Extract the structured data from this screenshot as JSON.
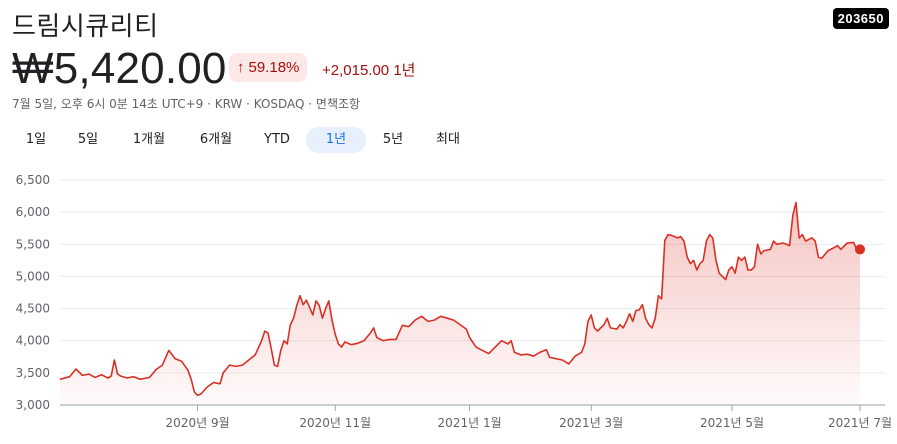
{
  "header": {
    "company_name": "드림시큐리티",
    "ticker": "203650"
  },
  "quote": {
    "price": "₩5,420.00",
    "percent_change": "59.18%",
    "abs_change": "+2,015.00 1년",
    "meta": "7월 5일, 오후 6시 0분 14초 UTC+9 · KRW · KOSDAQ · 면책조항"
  },
  "tabs": [
    {
      "label": "1일",
      "active": false
    },
    {
      "label": "5일",
      "active": false
    },
    {
      "label": "1개월",
      "active": false
    },
    {
      "label": "6개월",
      "active": false
    },
    {
      "label": "YTD",
      "active": false
    },
    {
      "label": "1년",
      "active": true
    },
    {
      "label": "5년",
      "active": false
    },
    {
      "label": "최대",
      "active": false
    }
  ],
  "colors": {
    "line": "#d93025",
    "positive": "#a50e0e",
    "badge_bg": "#fce8e6",
    "active_tab": "#1a73e8"
  },
  "chart_data": {
    "type": "area",
    "y_ticks": [
      "6,500",
      "6,000",
      "5,500",
      "5,000",
      "4,500",
      "4,000",
      "3,500",
      "3,000"
    ],
    "ylim": [
      3000,
      6500
    ],
    "x_ticks": [
      "2020년 9월",
      "2020년 11월",
      "2021년 1월",
      "2021년 3월",
      "2021년 5월",
      "2021년 7월"
    ],
    "x_tick_indices": [
      43,
      86,
      128,
      166,
      210,
      250
    ],
    "n_points": 251,
    "series": [
      {
        "values": [
          [
            0,
            3400
          ],
          [
            3,
            3440
          ],
          [
            5,
            3560
          ],
          [
            7,
            3460
          ],
          [
            9,
            3480
          ],
          [
            11,
            3430
          ],
          [
            13,
            3470
          ],
          [
            15,
            3420
          ],
          [
            16,
            3450
          ],
          [
            17,
            3700
          ],
          [
            18,
            3480
          ],
          [
            19,
            3450
          ],
          [
            21,
            3420
          ],
          [
            23,
            3440
          ],
          [
            25,
            3400
          ],
          [
            28,
            3430
          ],
          [
            30,
            3550
          ],
          [
            32,
            3620
          ],
          [
            34,
            3850
          ],
          [
            36,
            3720
          ],
          [
            38,
            3680
          ],
          [
            40,
            3540
          ],
          [
            41,
            3400
          ],
          [
            42,
            3200
          ],
          [
            43,
            3150
          ],
          [
            44,
            3170
          ],
          [
            46,
            3280
          ],
          [
            48,
            3350
          ],
          [
            50,
            3330
          ],
          [
            51,
            3500
          ],
          [
            53,
            3620
          ],
          [
            55,
            3600
          ],
          [
            57,
            3620
          ],
          [
            59,
            3700
          ],
          [
            61,
            3780
          ],
          [
            63,
            4000
          ],
          [
            64,
            4150
          ],
          [
            65,
            4120
          ],
          [
            66,
            3880
          ],
          [
            67,
            3620
          ],
          [
            68,
            3600
          ],
          [
            69,
            3850
          ],
          [
            70,
            4000
          ],
          [
            71,
            3950
          ],
          [
            72,
            4250
          ],
          [
            73,
            4350
          ],
          [
            74,
            4550
          ],
          [
            75,
            4700
          ],
          [
            76,
            4560
          ],
          [
            77,
            4630
          ],
          [
            78,
            4520
          ],
          [
            79,
            4400
          ],
          [
            80,
            4620
          ],
          [
            81,
            4550
          ],
          [
            82,
            4350
          ],
          [
            83,
            4500
          ],
          [
            84,
            4620
          ],
          [
            85,
            4320
          ],
          [
            86,
            4100
          ],
          [
            87,
            3950
          ],
          [
            88,
            3900
          ],
          [
            89,
            3980
          ],
          [
            91,
            3940
          ],
          [
            93,
            3960
          ],
          [
            95,
            4000
          ],
          [
            97,
            4120
          ],
          [
            98,
            4200
          ],
          [
            99,
            4050
          ],
          [
            101,
            4000
          ],
          [
            103,
            4020
          ],
          [
            105,
            4020
          ],
          [
            107,
            4240
          ],
          [
            109,
            4220
          ],
          [
            111,
            4320
          ],
          [
            113,
            4380
          ],
          [
            115,
            4300
          ],
          [
            117,
            4320
          ],
          [
            119,
            4380
          ],
          [
            121,
            4350
          ],
          [
            123,
            4320
          ],
          [
            125,
            4250
          ],
          [
            127,
            4180
          ],
          [
            128,
            4050
          ],
          [
            130,
            3900
          ],
          [
            132,
            3850
          ],
          [
            134,
            3800
          ],
          [
            136,
            3900
          ],
          [
            138,
            4000
          ],
          [
            140,
            3950
          ],
          [
            141,
            4000
          ],
          [
            142,
            3820
          ],
          [
            144,
            3780
          ],
          [
            146,
            3790
          ],
          [
            148,
            3760
          ],
          [
            150,
            3820
          ],
          [
            152,
            3860
          ],
          [
            153,
            3740
          ],
          [
            155,
            3720
          ],
          [
            157,
            3700
          ],
          [
            159,
            3640
          ],
          [
            161,
            3760
          ],
          [
            163,
            3820
          ],
          [
            164,
            3950
          ],
          [
            165,
            4300
          ],
          [
            166,
            4400
          ],
          [
            167,
            4200
          ],
          [
            168,
            4150
          ],
          [
            170,
            4250
          ],
          [
            171,
            4350
          ],
          [
            172,
            4200
          ],
          [
            174,
            4180
          ],
          [
            175,
            4250
          ],
          [
            176,
            4200
          ],
          [
            177,
            4300
          ],
          [
            178,
            4420
          ],
          [
            179,
            4300
          ],
          [
            180,
            4470
          ],
          [
            181,
            4480
          ],
          [
            182,
            4560
          ],
          [
            183,
            4350
          ],
          [
            184,
            4250
          ],
          [
            185,
            4200
          ],
          [
            186,
            4350
          ],
          [
            187,
            4700
          ],
          [
            188,
            4650
          ],
          [
            189,
            5560
          ],
          [
            190,
            5650
          ],
          [
            191,
            5640
          ],
          [
            193,
            5600
          ],
          [
            194,
            5620
          ],
          [
            195,
            5550
          ],
          [
            196,
            5300
          ],
          [
            197,
            5200
          ],
          [
            198,
            5250
          ],
          [
            199,
            5100
          ],
          [
            200,
            5200
          ],
          [
            201,
            5250
          ],
          [
            202,
            5550
          ],
          [
            203,
            5650
          ],
          [
            204,
            5600
          ],
          [
            205,
            5250
          ],
          [
            206,
            5050
          ],
          [
            207,
            5000
          ],
          [
            208,
            4950
          ],
          [
            209,
            5100
          ],
          [
            210,
            5150
          ],
          [
            211,
            5050
          ],
          [
            212,
            5300
          ],
          [
            213,
            5250
          ],
          [
            214,
            5300
          ],
          [
            215,
            5100
          ],
          [
            216,
            5100
          ],
          [
            217,
            5150
          ],
          [
            218,
            5500
          ],
          [
            219,
            5350
          ],
          [
            220,
            5400
          ],
          [
            222,
            5420
          ],
          [
            223,
            5550
          ],
          [
            224,
            5500
          ],
          [
            226,
            5520
          ],
          [
            228,
            5480
          ],
          [
            229,
            5950
          ],
          [
            230,
            6150
          ],
          [
            231,
            5600
          ],
          [
            232,
            5650
          ],
          [
            233,
            5550
          ],
          [
            235,
            5600
          ],
          [
            236,
            5550
          ],
          [
            237,
            5300
          ],
          [
            238,
            5280
          ],
          [
            240,
            5400
          ],
          [
            242,
            5450
          ],
          [
            243,
            5480
          ],
          [
            244,
            5420
          ],
          [
            246,
            5520
          ],
          [
            248,
            5530
          ],
          [
            249,
            5420
          ],
          [
            250,
            5420
          ]
        ]
      }
    ],
    "last_value": 5420
  }
}
